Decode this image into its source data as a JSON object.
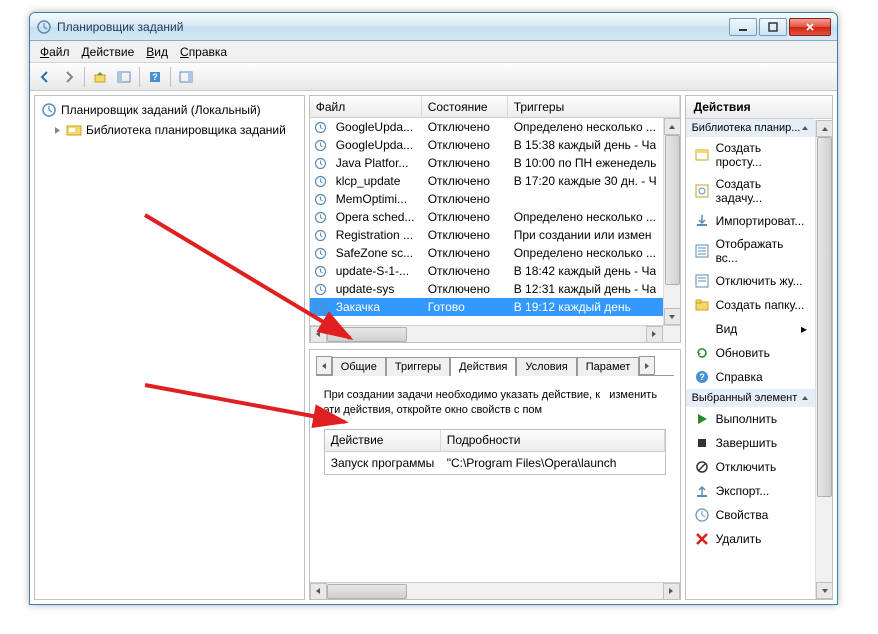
{
  "window": {
    "title": "Планировщик заданий"
  },
  "menu": {
    "file": "Файл",
    "action": "Действие",
    "view": "Вид",
    "help": "Справка"
  },
  "tree": {
    "root": "Планировщик заданий (Локальный)",
    "child": "Библиотека планировщика заданий"
  },
  "taskColumns": {
    "file": "Файл",
    "state": "Состояние",
    "triggers": "Триггеры"
  },
  "tasks": [
    {
      "name": "GoogleUpda...",
      "state": "Отключено",
      "trigger": "Определено несколько ..."
    },
    {
      "name": "GoogleUpda...",
      "state": "Отключено",
      "trigger": "В 15:38 каждый день - Ча"
    },
    {
      "name": "Java Platfor...",
      "state": "Отключено",
      "trigger": "В 10:00 по ПН еженедель"
    },
    {
      "name": "klcp_update",
      "state": "Отключено",
      "trigger": "В 17:20 каждые 30 дн. - Ч"
    },
    {
      "name": "MemOptimi...",
      "state": "Отключено",
      "trigger": ""
    },
    {
      "name": "Opera sched...",
      "state": "Отключено",
      "trigger": "Определено несколько ..."
    },
    {
      "name": "Registration ...",
      "state": "Отключено",
      "trigger": "При создании или измен"
    },
    {
      "name": "SafeZone sc...",
      "state": "Отключено",
      "trigger": "Определено несколько ..."
    },
    {
      "name": "update-S-1-...",
      "state": "Отключено",
      "trigger": "В 18:42 каждый день - Ча"
    },
    {
      "name": "update-sys",
      "state": "Отключено",
      "trigger": "В 12:31 каждый день - Ча"
    },
    {
      "name": "Закачка",
      "state": "Готово",
      "trigger": "В 19:12 каждый день"
    }
  ],
  "tabs": {
    "general": "Общие",
    "triggers": "Триггеры",
    "actions": "Действия",
    "conditions": "Условия",
    "params": "Парамет"
  },
  "helpText": "При создании задачи необходимо указать действие, к   изменить эти действия, откройте окно свойств с пом",
  "innerCols": {
    "action": "Действие",
    "detail": "Подробности"
  },
  "innerRow": {
    "action": "Запуск программы",
    "detail": "\"C:\\Program Files\\Opera\\launch"
  },
  "actionsPanel": {
    "title": "Действия",
    "section1": "Библиотека планир...",
    "items1": [
      {
        "icon": "wizard",
        "label": "Создать просту..."
      },
      {
        "icon": "task",
        "label": "Создать задачу..."
      },
      {
        "icon": "import",
        "label": "Импортироват..."
      },
      {
        "icon": "list",
        "label": "Отображать вс..."
      },
      {
        "icon": "disable-log",
        "label": "Отключить жу..."
      },
      {
        "icon": "folder",
        "label": "Создать папку..."
      },
      {
        "icon": "view",
        "label": "Вид"
      },
      {
        "icon": "refresh",
        "label": "Обновить"
      },
      {
        "icon": "help",
        "label": "Справка"
      }
    ],
    "section2": "Выбранный элемент",
    "items2": [
      {
        "icon": "run",
        "label": "Выполнить"
      },
      {
        "icon": "stop",
        "label": "Завершить"
      },
      {
        "icon": "disable",
        "label": "Отключить"
      },
      {
        "icon": "export",
        "label": "Экспорт..."
      },
      {
        "icon": "props",
        "label": "Свойства"
      },
      {
        "icon": "delete",
        "label": "Удалить"
      }
    ]
  }
}
